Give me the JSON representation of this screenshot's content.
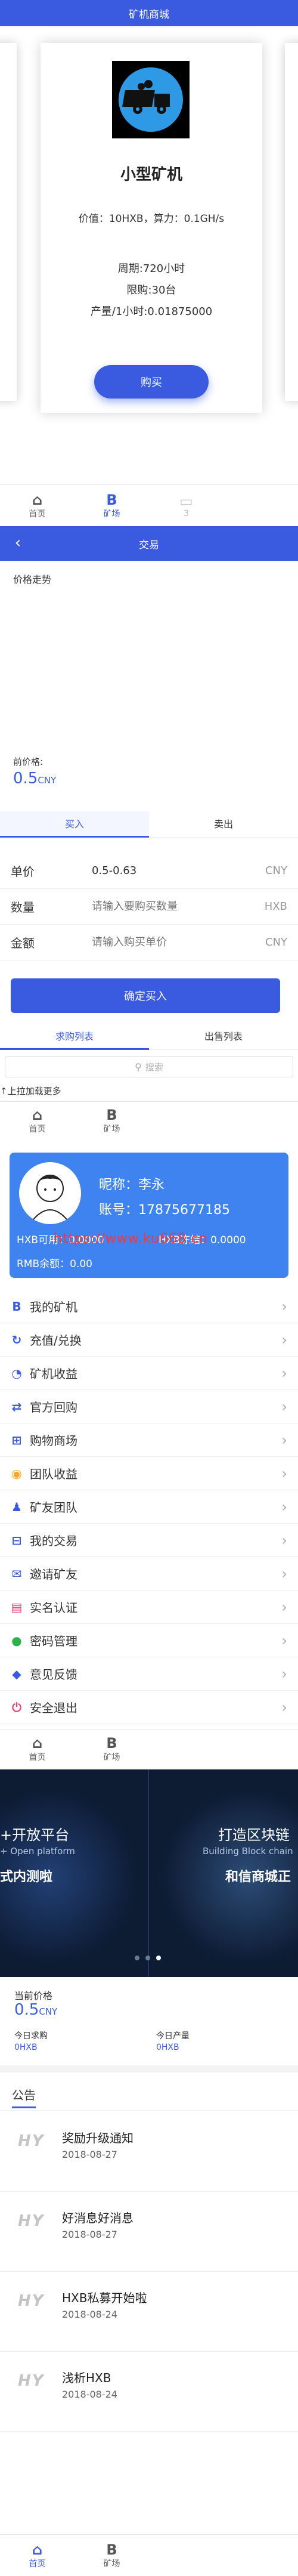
{
  "colors": {
    "accent": "#3a5be0",
    "link": "#3a5be0",
    "watermark": "#ff3333",
    "banner_bg": "#0d1b33"
  },
  "mall": {
    "title": "矿机商城",
    "product": {
      "icon": "mining-truck-icon",
      "name": "小型矿机",
      "price_line": "价值：10HXB，算力：0.1GH/s",
      "period": "周期:720小时",
      "limit": "限购:30台",
      "output": "产量/1小时:0.01875000",
      "buy_label": "购买"
    }
  },
  "tabs1": {
    "home": "首页",
    "miner": "矿场",
    "home_icon": "home-icon",
    "miner_icon": "bitcoin-icon",
    "third": "3"
  },
  "trade": {
    "title": "交易",
    "trend_label": "价格走势",
    "current_label": "前价格:",
    "current_value": "0.5",
    "current_unit": "CNY",
    "buy_tab": "买入",
    "sell_tab": "卖出",
    "fields": [
      {
        "label": "单价",
        "value": "0.5-0.63",
        "unit": "CNY"
      },
      {
        "label": "数量",
        "placeholder": "请输入要购买数量",
        "unit": "HXB"
      },
      {
        "label": "金额",
        "placeholder": "请输入购买单价",
        "unit": "CNY"
      }
    ],
    "confirm_label": "确定买入",
    "list_tabs": [
      "求购列表",
      "出售列表"
    ],
    "search_placeholder": "搜索",
    "pull_hint": "上拉加载更多"
  },
  "tabs2": {
    "home": "首页",
    "miner": "矿场"
  },
  "profile": {
    "nick_label": "昵称：",
    "nick": "李永",
    "account_label": "账号：",
    "account": "17875677185",
    "hxb_avail": "HXB可用：0.0000",
    "hxb_frozen": "HXB冻结：0.0000",
    "rmb": "RMB余额：0.00",
    "watermark": "https://www.ku668.cn"
  },
  "menu": [
    {
      "label": "我的矿机",
      "icon": "bitcoin-icon",
      "color": "#3a5be0"
    },
    {
      "label": "充值/兑换",
      "icon": "recharge-icon",
      "color": "#3a5be0"
    },
    {
      "label": "矿机收益",
      "icon": "pie-chart-icon",
      "color": "#3a5be0"
    },
    {
      "label": "官方回购",
      "icon": "buyback-icon",
      "color": "#3a5be0"
    },
    {
      "label": "购物商场",
      "icon": "cart-icon",
      "color": "#3a5be0"
    },
    {
      "label": "团队收益",
      "icon": "team-income-icon",
      "color": "#f5a623"
    },
    {
      "label": "矿友团队",
      "icon": "team-icon",
      "color": "#3a5be0"
    },
    {
      "label": "我的交易",
      "icon": "trade-icon",
      "color": "#3a5be0"
    },
    {
      "label": "邀请矿友",
      "icon": "invite-icon",
      "color": "#3a5be0"
    },
    {
      "label": "实名认证",
      "icon": "id-card-icon",
      "color": "#e0457b"
    },
    {
      "label": "密码管理",
      "icon": "lock-icon",
      "color": "#2bb24c"
    },
    {
      "label": "意见反馈",
      "icon": "feedback-icon",
      "color": "#3a5be0"
    },
    {
      "label": "安全退出",
      "icon": "logout-icon",
      "color": "#e0457b"
    }
  ],
  "tabs3": {
    "home": "首页",
    "miner": "矿场"
  },
  "banner": {
    "left_line1": "+开放平台",
    "left_line2": "+ Open platform",
    "left_line3": "式内测啦",
    "right_line1": "打造区块链",
    "right_line2": "Building Block chain",
    "right_line3": "和信商城正"
  },
  "home_price": {
    "label": "当前价格",
    "value": "0.5",
    "unit": "CNY",
    "today_buy_label": "今日求购",
    "today_buy_value": "0HXB",
    "today_out_label": "今日产量",
    "today_out_value": "0HXB"
  },
  "notices": {
    "title": "公告",
    "items": [
      {
        "title": "奖励升级通知",
        "date": "2018-08-27"
      },
      {
        "title": "好消息好消息",
        "date": "2018-08-27"
      },
      {
        "title": "HXB私募开始啦",
        "date": "2018-08-24"
      },
      {
        "title": "浅析HXB",
        "date": "2018-08-24"
      }
    ],
    "logo": "HY"
  },
  "tabs4": {
    "home": "首页",
    "miner": "矿场"
  }
}
